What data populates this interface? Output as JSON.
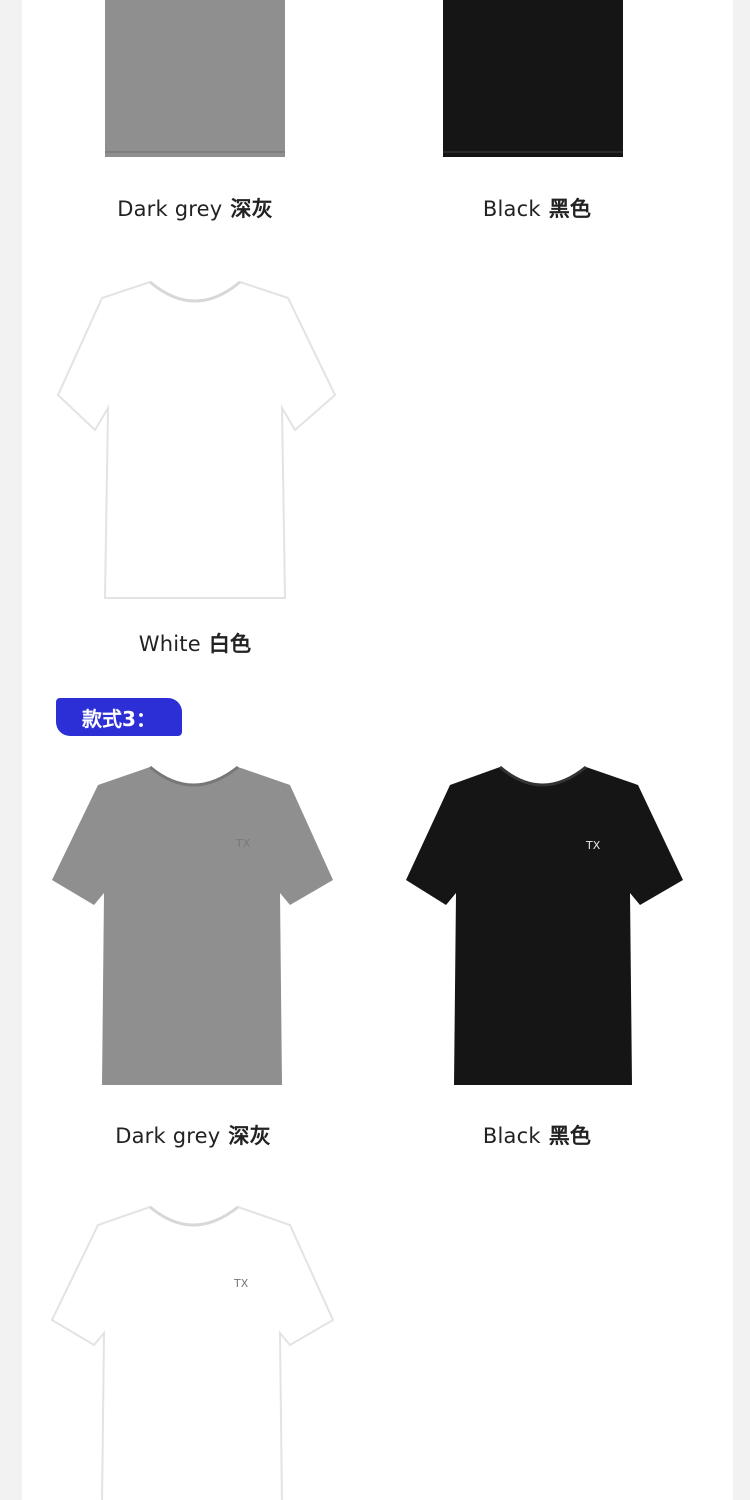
{
  "section3": {
    "badge": "款式3："
  },
  "colors": {
    "badge": "#2c2fd6",
    "grey": "#8f8f8f",
    "black": "#151515",
    "white": "#ffffff"
  },
  "row1": [
    {
      "en": "Dark grey",
      "cn": "深灰",
      "shirt": "grey-tshirt-icon"
    },
    {
      "en": "Black",
      "cn": "黑色",
      "shirt": "black-tshirt-icon"
    }
  ],
  "row2": [
    {
      "en": "White",
      "cn": "白色",
      "shirt": "white-tshirt-icon"
    }
  ],
  "row3": [
    {
      "en": "Dark grey",
      "cn": "深灰",
      "shirt": "grey-tshirt-icon"
    },
    {
      "en": "Black",
      "cn": "黑色",
      "shirt": "black-tshirt-icon"
    }
  ],
  "row4": [
    {
      "shirt": "white-tshirt-icon"
    }
  ]
}
